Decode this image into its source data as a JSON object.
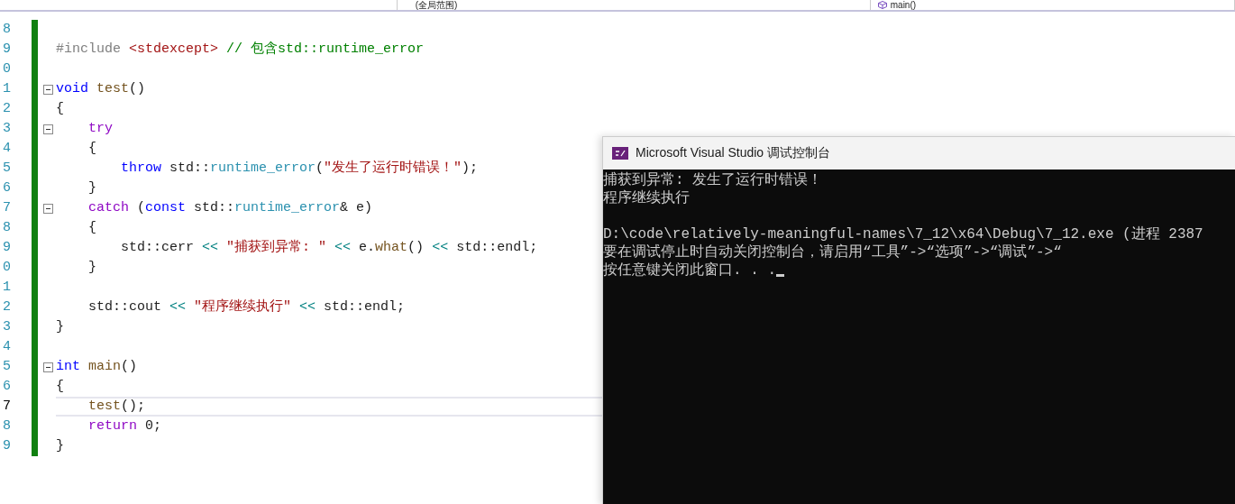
{
  "navigation_bar": {
    "scope": "(全局范围)",
    "member": "main()"
  },
  "editor": {
    "lines": [
      {
        "number": "8",
        "fold": false,
        "current": false
      },
      {
        "number": "9",
        "fold": false,
        "current": false,
        "tokens": [
          {
            "kind": "preprocessor",
            "text": "#include "
          },
          {
            "kind": "string",
            "text": "<stdexcept>"
          },
          {
            "kind": "comment",
            "text": " // 包含std::runtime_error"
          }
        ]
      },
      {
        "number": "0",
        "fold": false,
        "current": false
      },
      {
        "number": "1",
        "fold": true,
        "current": false,
        "tokens": [
          {
            "kind": "keyword",
            "text": "void "
          },
          {
            "kind": "function",
            "text": "test"
          },
          {
            "kind": "plain",
            "text": "()"
          }
        ]
      },
      {
        "number": "2",
        "fold": false,
        "current": false,
        "tokens": [
          {
            "kind": "plain",
            "text": "{"
          }
        ]
      },
      {
        "number": "3",
        "fold": true,
        "current": false,
        "tokens": [
          {
            "kind": "control",
            "text": "    try"
          }
        ]
      },
      {
        "number": "4",
        "fold": false,
        "current": false,
        "tokens": [
          {
            "kind": "plain",
            "text": "    {"
          }
        ]
      },
      {
        "number": "5",
        "fold": false,
        "current": false,
        "tokens": [
          {
            "kind": "keyword",
            "text": "        throw"
          },
          {
            "kind": "plain",
            "text": " std::"
          },
          {
            "kind": "type",
            "text": "runtime_error"
          },
          {
            "kind": "plain",
            "text": "("
          },
          {
            "kind": "string",
            "text": "\"发生了运行时错误！\""
          },
          {
            "kind": "plain",
            "text": ");"
          }
        ]
      },
      {
        "number": "6",
        "fold": false,
        "current": false,
        "tokens": [
          {
            "kind": "plain",
            "text": "    }"
          }
        ]
      },
      {
        "number": "7",
        "fold": true,
        "current": false,
        "tokens": [
          {
            "kind": "control",
            "text": "    catch"
          },
          {
            "kind": "plain",
            "text": " ("
          },
          {
            "kind": "keyword",
            "text": "const"
          },
          {
            "kind": "plain",
            "text": " std::"
          },
          {
            "kind": "type",
            "text": "runtime_error"
          },
          {
            "kind": "plain",
            "text": "& e)"
          }
        ]
      },
      {
        "number": "8",
        "fold": false,
        "current": false,
        "tokens": [
          {
            "kind": "plain",
            "text": "    {"
          }
        ]
      },
      {
        "number": "9",
        "fold": false,
        "current": false,
        "tokens": [
          {
            "kind": "plain",
            "text": "        std::cerr "
          },
          {
            "kind": "operator",
            "text": "<<"
          },
          {
            "kind": "string",
            "text": " \"捕获到异常: \" "
          },
          {
            "kind": "operator",
            "text": "<<"
          },
          {
            "kind": "plain",
            "text": " e."
          },
          {
            "kind": "function",
            "text": "what"
          },
          {
            "kind": "plain",
            "text": "() "
          },
          {
            "kind": "operator",
            "text": "<<"
          },
          {
            "kind": "plain",
            "text": " std::endl;"
          }
        ]
      },
      {
        "number": "0",
        "fold": false,
        "current": false,
        "tokens": [
          {
            "kind": "plain",
            "text": "    }"
          }
        ]
      },
      {
        "number": "1",
        "fold": false,
        "current": false
      },
      {
        "number": "2",
        "fold": false,
        "current": false,
        "tokens": [
          {
            "kind": "plain",
            "text": "    std::cout "
          },
          {
            "kind": "operator",
            "text": "<<"
          },
          {
            "kind": "string",
            "text": " \"程序继续执行\" "
          },
          {
            "kind": "operator",
            "text": "<<"
          },
          {
            "kind": "plain",
            "text": " std::endl;"
          }
        ]
      },
      {
        "number": "3",
        "fold": false,
        "current": false,
        "tokens": [
          {
            "kind": "plain",
            "text": "}"
          }
        ]
      },
      {
        "number": "4",
        "fold": false,
        "current": false
      },
      {
        "number": "5",
        "fold": true,
        "current": false,
        "tokens": [
          {
            "kind": "keyword",
            "text": "int "
          },
          {
            "kind": "function",
            "text": "main"
          },
          {
            "kind": "plain",
            "text": "()"
          }
        ]
      },
      {
        "number": "6",
        "fold": false,
        "current": false,
        "tokens": [
          {
            "kind": "plain",
            "text": "{"
          }
        ]
      },
      {
        "number": "7",
        "fold": false,
        "current": true,
        "tokens": [
          {
            "kind": "function",
            "text": "    test"
          },
          {
            "kind": "plain",
            "text": "();"
          }
        ]
      },
      {
        "number": "8",
        "fold": false,
        "current": false,
        "tokens": [
          {
            "kind": "control",
            "text": "    return"
          },
          {
            "kind": "plain",
            "text": " 0;"
          }
        ]
      },
      {
        "number": "9",
        "fold": false,
        "current": false,
        "tokens": [
          {
            "kind": "plain",
            "text": "}"
          }
        ]
      }
    ]
  },
  "console": {
    "title": "Microsoft Visual Studio 调试控制台",
    "program_output": [
      "捕获到异常: 发生了运行时错误！",
      "程序继续执行"
    ],
    "exit_messages": [
      "D:\\code\\relatively-meaningful-names\\7_12\\x64\\Debug\\7_12.exe (进程 2387",
      "要在调试停止时自动关闭控制台，请启用“工具”->“选项”->“调试”->“",
      "按任意键关闭此窗口. . ."
    ]
  }
}
